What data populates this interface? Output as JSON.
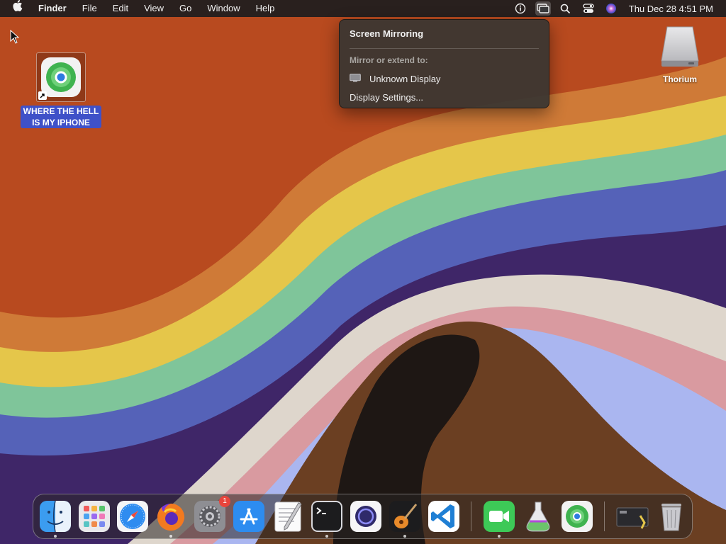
{
  "menubar": {
    "apple": "",
    "app_name": "Finder",
    "menus": [
      "File",
      "Edit",
      "View",
      "Go",
      "Window",
      "Help"
    ],
    "clock": "Thu Dec 28  4:51 PM",
    "icons": [
      "accessibility-icon",
      "screen-mirroring-icon",
      "spotlight-search-icon",
      "control-center-icon",
      "siri-icon"
    ]
  },
  "mirror_menu": {
    "title": "Screen Mirroring",
    "section": "Mirror or extend to:",
    "display": "Unknown Display",
    "settings": "Display Settings..."
  },
  "desktop": {
    "findmy_label": "WHERE THE HELL IS MY IPHONE",
    "thorium_label": "Thorium"
  },
  "dock": {
    "apps": [
      "Finder",
      "Launchpad",
      "Safari",
      "Firefox",
      "System Settings",
      "App Store",
      "TextEdit",
      "Terminal",
      "Screen Mirroring",
      "GarageBand",
      "Visual Studio Code",
      "FaceTime",
      "Automator",
      "Find My",
      "Script Editor",
      "Trash"
    ],
    "system_settings_badge": "1"
  },
  "colors": {
    "wallpaper_orange": "#b84a1f",
    "menu_selection": "#3f51c8"
  }
}
